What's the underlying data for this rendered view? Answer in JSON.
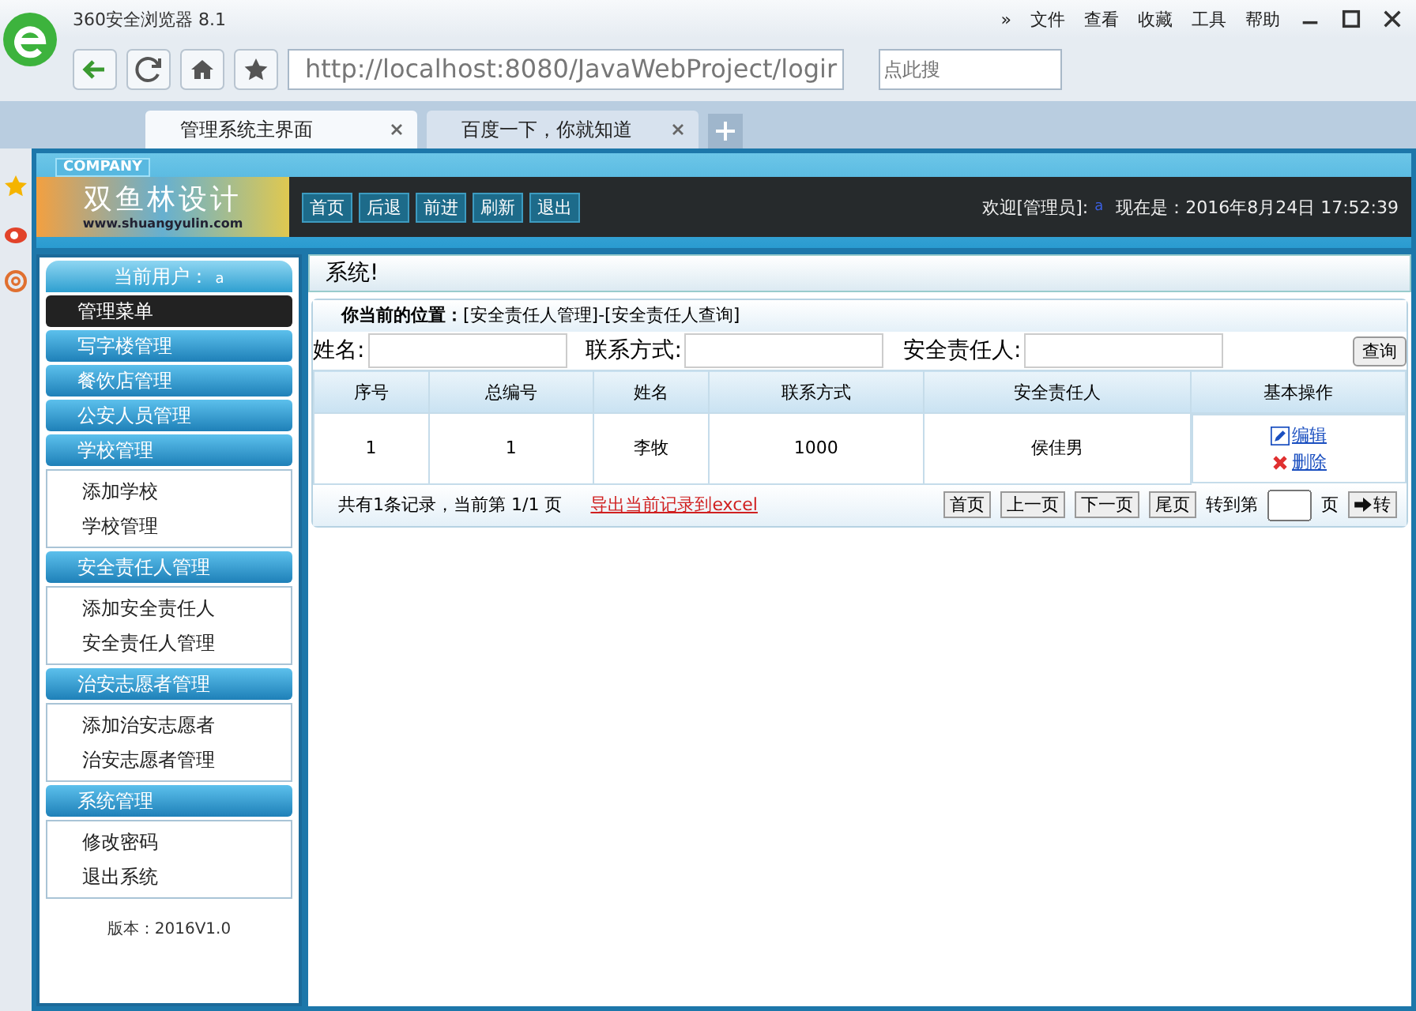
{
  "browser": {
    "title": "360安全浏览器 8.1",
    "menu": [
      "»",
      "文件",
      "查看",
      "收藏",
      "工具",
      "帮助"
    ],
    "address": "http://localhost:8080/JavaWebProject/logir",
    "search_placeholder": "点此搜",
    "tabs": [
      {
        "label": "管理系统主界面",
        "selected": true
      },
      {
        "label": "百度一下，你就知道",
        "selected": false
      }
    ]
  },
  "header": {
    "company": "COMPANY",
    "logo": "双鱼林设计",
    "logo_url": "www.shuangyulin.com",
    "nav": [
      "首页",
      "后退",
      "前进",
      "刷新",
      "退出"
    ],
    "welcome": "欢迎[管理员]:",
    "user": "a",
    "time": "现在是：2016年8月24日 17:52:39"
  },
  "sidebar": {
    "current_user_label": "当前用户：",
    "current_user": "a",
    "menu_title": "管理菜单",
    "groups": [
      {
        "title": "写字楼管理"
      },
      {
        "title": "餐饮店管理"
      },
      {
        "title": "公安人员管理"
      },
      {
        "title": "学校管理",
        "items": [
          "添加学校",
          "学校管理"
        ]
      },
      {
        "title": "安全责任人管理",
        "items": [
          "添加安全责任人",
          "安全责任人管理"
        ]
      },
      {
        "title": "治安志愿者管理",
        "items": [
          "添加治安志愿者",
          "治安志愿者管理"
        ]
      },
      {
        "title": "系统管理",
        "items": [
          "修改密码",
          "退出系统"
        ]
      }
    ],
    "version": "版本：2016V1.0"
  },
  "marquee": "系统!",
  "breadcrumb": {
    "label": "你当前的位置：",
    "path": "[安全责任人管理]-[安全责任人查询]"
  },
  "search": {
    "fields": [
      {
        "label": "姓名:"
      },
      {
        "label": "联系方式:"
      },
      {
        "label": "安全责任人:"
      }
    ],
    "button": "查询"
  },
  "table": {
    "columns": [
      "序号",
      "总编号",
      "姓名",
      "联系方式",
      "安全责任人",
      "基本操作"
    ],
    "rows": [
      {
        "cells": [
          "1",
          "1",
          "李牧",
          "1000",
          "侯佳男"
        ],
        "actions": [
          "编辑",
          "删除"
        ]
      }
    ]
  },
  "pager": {
    "summary": "共有1条记录，当前第 1/1 页",
    "export": "导出当前记录到excel",
    "buttons": [
      "首页",
      "上一页",
      "下一页",
      "尾页"
    ],
    "goto": "转到第",
    "page": "页",
    "go": "转"
  }
}
